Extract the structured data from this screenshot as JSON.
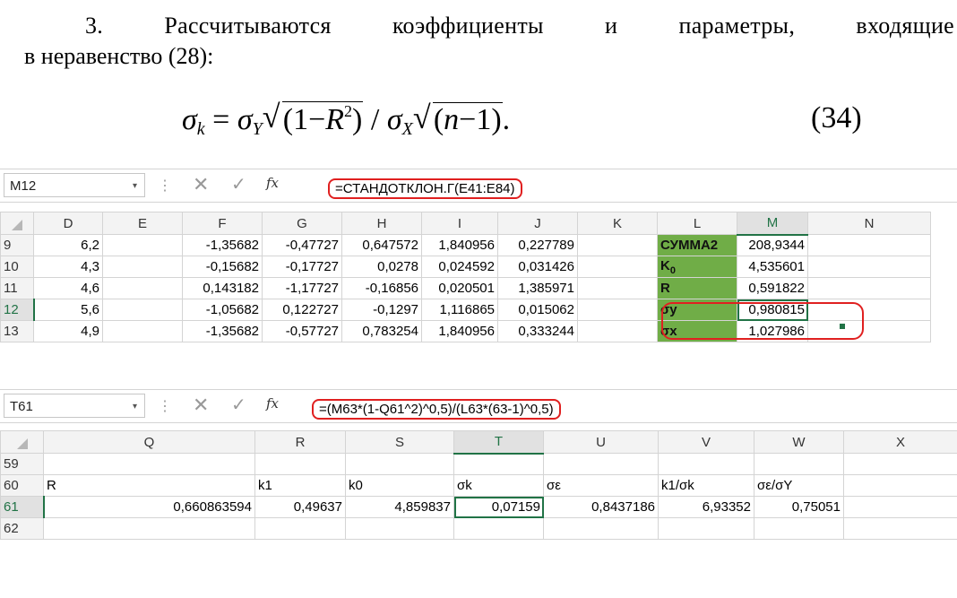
{
  "document": {
    "line1": "3. Рассчитываются коэффициенты и параметры, входящие",
    "line2": "в неравенство (28):",
    "formula": {
      "lhs_sym": "σ",
      "lhs_sub": "k",
      "eq": " = ",
      "s_y": "σ",
      "s_y_sub": "Y",
      "rad_inner_1": "(1−",
      "r": "R",
      "sup2": "2",
      "rad_inner_close": ")",
      "slash": " / ",
      "s_x": "σ",
      "s_x_sub": "X",
      "rad2_open": "(",
      "n": "n",
      "rad2_rest": "−1)",
      "dot": "."
    },
    "eq_number": "(34)"
  },
  "sheet1": {
    "namebox": "M12",
    "formula": "=СТАНДОТКЛОН.Г(E41:E84)",
    "columns": [
      "D",
      "E",
      "F",
      "G",
      "H",
      "I",
      "J",
      "K",
      "L",
      "M",
      "N"
    ],
    "active_column": "M",
    "active_row": "12",
    "rows": [
      {
        "row": "9",
        "D": "6,2",
        "E": "",
        "F": "-1,35682",
        "G": "-0,47727",
        "H": "0,647572",
        "I": "1,840956",
        "J": "0,227789",
        "K": "",
        "L": "СУММА2",
        "M": "208,9344",
        "N": ""
      },
      {
        "row": "10",
        "D": "4,3",
        "E": "",
        "F": "-0,15682",
        "G": "-0,17727",
        "H": "0,0278",
        "I": "0,024592",
        "J": "0,031426",
        "K": "",
        "L": "K",
        "L_sub": "0",
        "M": "4,535601",
        "N": ""
      },
      {
        "row": "11",
        "D": "4,6",
        "E": "",
        "F": "0,143182",
        "G": "-1,17727",
        "H": "-0,16856",
        "I": "0,020501",
        "J": "1,385971",
        "K": "",
        "L": "R",
        "M": "0,591822",
        "N": ""
      },
      {
        "row": "12",
        "D": "5,6",
        "E": "",
        "F": "-1,05682",
        "G": "0,122727",
        "H": "-0,1297",
        "I": "1,116865",
        "J": "0,015062",
        "K": "",
        "L": "σy",
        "M": "0,980815",
        "N": ""
      },
      {
        "row": "13",
        "D": "4,9",
        "E": "",
        "F": "-1,35682",
        "G": "-0,57727",
        "H": "0,783254",
        "I": "1,840956",
        "J": "0,333244",
        "K": "",
        "L": "σx",
        "M": "1,027986",
        "N": ""
      }
    ]
  },
  "sheet2": {
    "namebox": "T61",
    "formula": "=(M63*(1-Q61^2)^0,5)/(L63*(63-1)^0,5)",
    "columns": [
      "Q",
      "R",
      "S",
      "T",
      "U",
      "V",
      "W",
      "X"
    ],
    "active_column": "T",
    "active_row": "61",
    "rows": [
      {
        "row": "59",
        "Q": "",
        "R": "",
        "S": "",
        "T": "",
        "U": "",
        "V": "",
        "W": "",
        "X": ""
      },
      {
        "row": "60",
        "Q": "R",
        "R": "k1",
        "S": "k0",
        "T": "σk",
        "U": "σε",
        "V": "k1/σk",
        "W": "σε/σY",
        "X": ""
      },
      {
        "row": "61",
        "Q": "0,660863594",
        "R": "0,49637",
        "S": "4,859837",
        "T": "0,07159",
        "U": "0,8437186",
        "V": "6,93352",
        "W": "0,75051",
        "X": ""
      },
      {
        "row": "62",
        "Q": "",
        "R": "",
        "S": "",
        "T": "",
        "U": "",
        "V": "",
        "W": "",
        "X": ""
      }
    ]
  },
  "icons": {
    "cancel": "✕",
    "enter": "✓",
    "fx": "fx",
    "dropdown": "▾",
    "sep": "⋮"
  },
  "colors": {
    "label_fill": "#70ad47",
    "highlight_ring": "#e02020",
    "excel_green": "#217346"
  }
}
